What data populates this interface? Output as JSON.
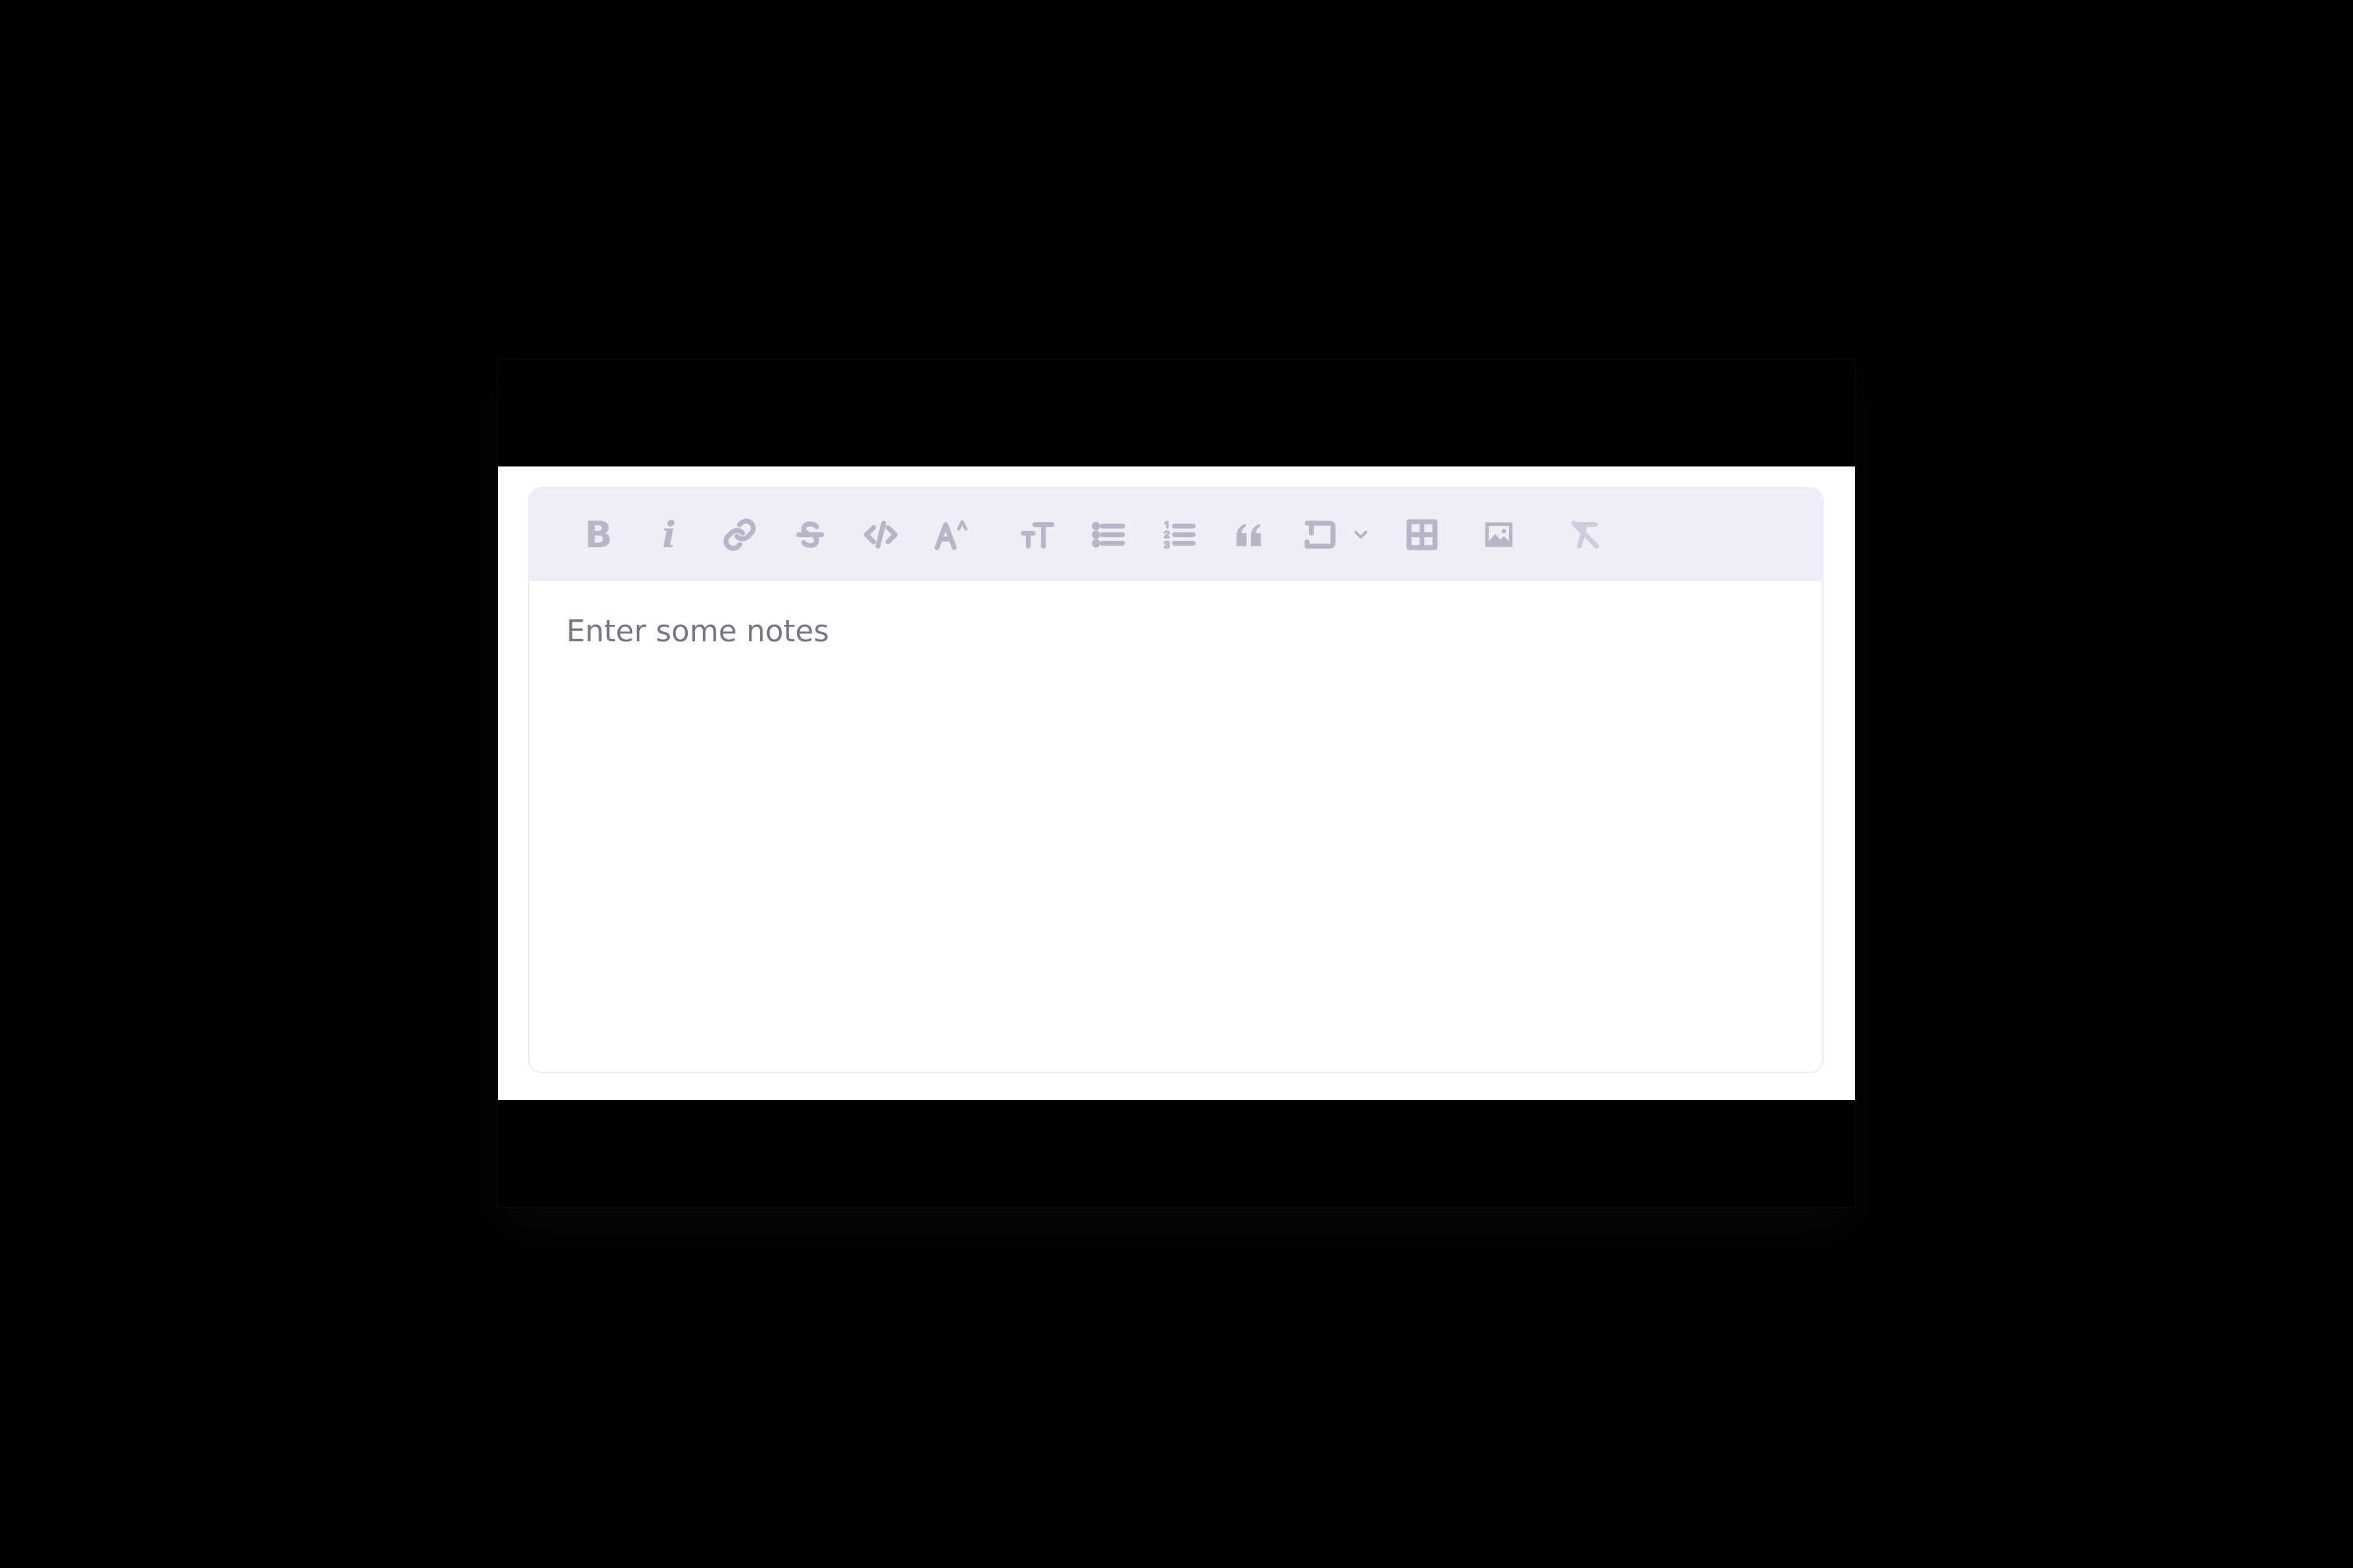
{
  "editor": {
    "placeholder": "Enter some notes"
  },
  "toolbar": {
    "buttons": [
      {
        "name": "bold",
        "icon": "bold-icon",
        "glyph": "B"
      },
      {
        "name": "italic",
        "icon": "italic-icon",
        "glyph": "i"
      },
      {
        "name": "link",
        "icon": "link-icon"
      },
      {
        "name": "strikethrough",
        "icon": "strikethrough-icon"
      },
      {
        "name": "code",
        "icon": "code-icon"
      },
      {
        "name": "superscript",
        "icon": "superscript-icon"
      },
      {
        "name": "heading",
        "icon": "heading-icon"
      },
      {
        "name": "bullet-list",
        "icon": "bullet-list-icon"
      },
      {
        "name": "numbered-list",
        "icon": "numbered-list-icon"
      },
      {
        "name": "blockquote",
        "icon": "quote-icon"
      },
      {
        "name": "text-block",
        "icon": "text-block-icon"
      },
      {
        "name": "text-block-dropdown",
        "icon": "chevron-down-icon"
      },
      {
        "name": "table",
        "icon": "table-icon"
      },
      {
        "name": "image",
        "icon": "image-icon"
      },
      {
        "name": "clear-formatting",
        "icon": "clear-format-icon"
      }
    ]
  },
  "colors": {
    "toolbar_bg": "#efeef4",
    "icon": "#b7b5c8",
    "placeholder_text": "#777783",
    "border": "#eeedf3"
  }
}
